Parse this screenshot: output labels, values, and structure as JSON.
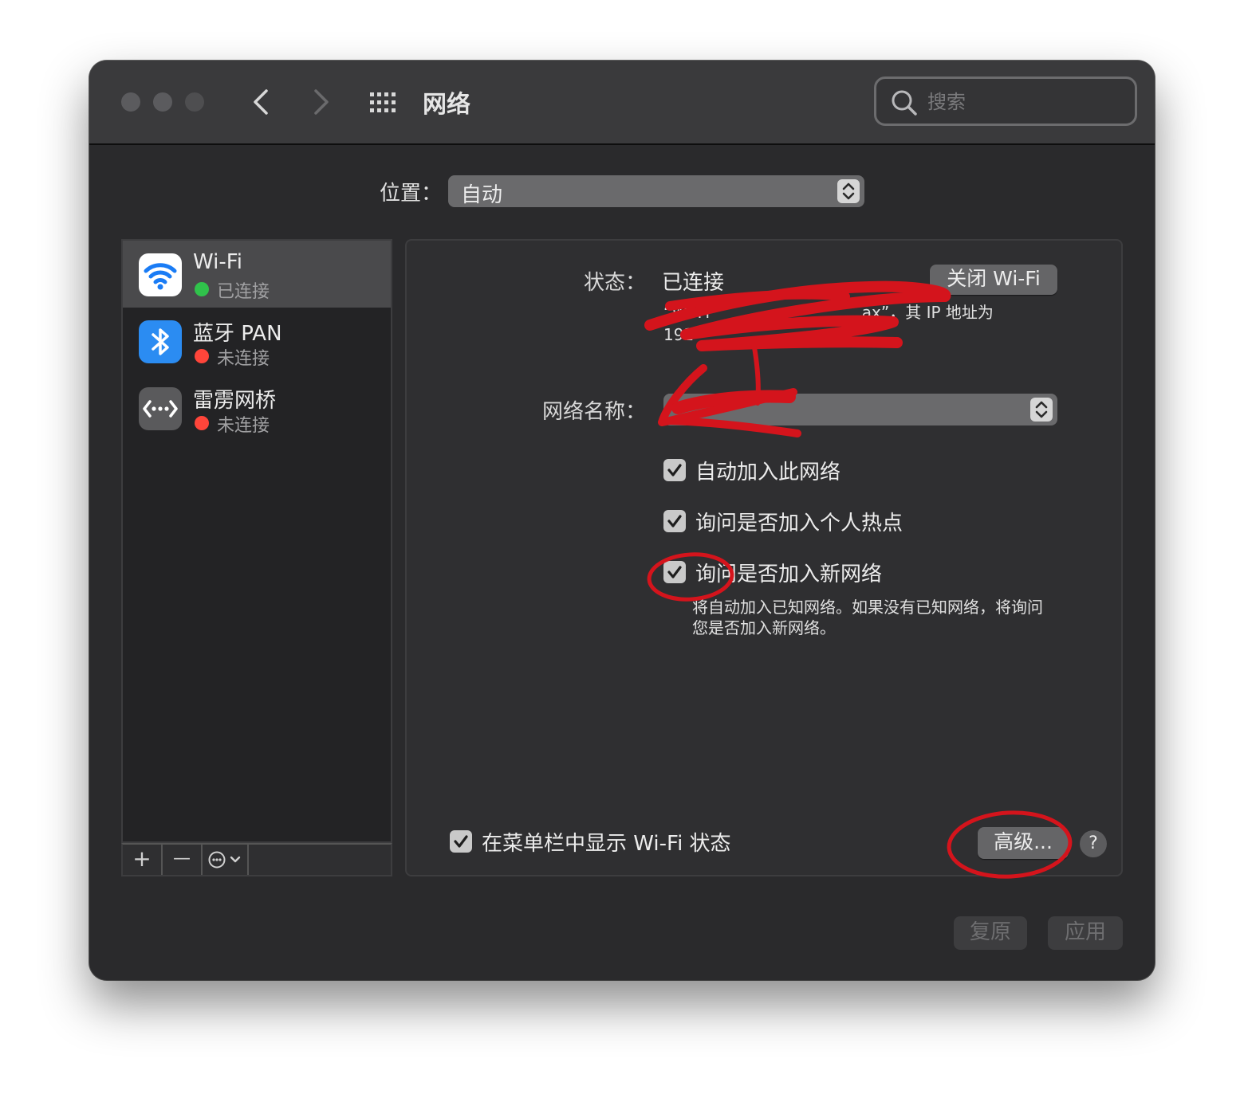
{
  "window": {
    "title": "网络",
    "search": {
      "placeholder": "搜索",
      "value": ""
    }
  },
  "location": {
    "label": "位置：",
    "value": "自动"
  },
  "services": [
    {
      "name": "Wi-Fi",
      "status": "已连接",
      "status_color": "#30c24b",
      "icon": "wifi-icon",
      "selected": true
    },
    {
      "name": "蓝牙 PAN",
      "status": "未连接",
      "status_color": "#ff453a",
      "icon": "bluetooth-icon",
      "selected": false
    },
    {
      "name": "雷雳网桥",
      "status": "未连接",
      "status_color": "#ff453a",
      "icon": "thunderbolt-bridge-icon",
      "selected": false
    }
  ],
  "sidebar_toolbar": {
    "add": "+",
    "remove": "—"
  },
  "detail": {
    "status_label": "状态：",
    "status_value": "已连接",
    "turn_off_button": "关闭 Wi-Fi",
    "status_desc_line1": "“Wi-Fi                              ax”，其 IP 地址为",
    "status_desc_line2": "192",
    "network_name_label": "网络名称：",
    "network_name_value": "",
    "checkboxes": [
      {
        "label": "自动加入此网络",
        "checked": true
      },
      {
        "label": "询问是否加入个人热点",
        "checked": true
      },
      {
        "label": "询问是否加入新网络",
        "checked": true
      }
    ],
    "hint_line1": "将自动加入已知网络。如果没有已知网络，将询问",
    "hint_line2": "您是否加入新网络。",
    "menubar_checkbox": {
      "label": "在菜单栏中显示 Wi-Fi 状态",
      "checked": true
    },
    "advanced_button": "高级...",
    "help_button": "?"
  },
  "footer": {
    "revert": "复原",
    "apply": "应用"
  },
  "colors": {
    "window_bg": "#2a2a2c",
    "titlebar_bg": "#3a3a3c",
    "annotation_red": "#d4141c",
    "wifi_blue": "#1a7cf5",
    "bluetooth_blue": "#2b8cf2"
  }
}
